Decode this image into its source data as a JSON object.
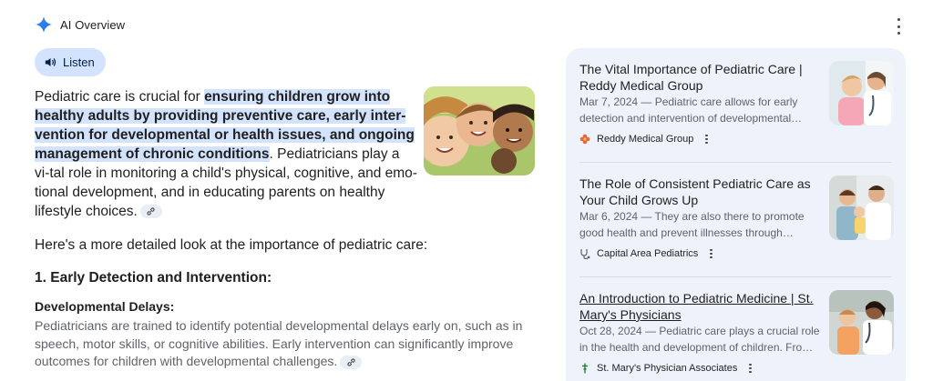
{
  "header": {
    "title": "AI Overview"
  },
  "listen": {
    "label": "Listen"
  },
  "overview": {
    "intro_before": "Pediatric care is crucial for ",
    "intro_highlight": "ensuring children grow into healthy adults by providing preventive care, early inter-vention for developmental or health issues, and ongoing management of chronic conditions",
    "intro_after": ". Pediatricians play a vi-tal role in monitoring a child's physical, cognitive, and emo-tional development, and in educating parents on healthy lifestyle choices.",
    "detail_intro": "Here's a more detailed look at the importance of pediatric care:",
    "section_heading": "1. Early Detection and Intervention:",
    "sub_heading": "Developmental Delays:",
    "sub_text": "Pediatricians are trained to identify potential developmental delays early on, such as in speech, motor skills, or cognitive abilities. Early intervention can significantly improve outcomes for children with developmental challenges."
  },
  "sources": [
    {
      "title": "The Vital Importance of Pediatric Care | Reddy Medical Group",
      "snippet": "Mar 7, 2024 — Pediatric care allows for early detection and intervention of developmental…",
      "site": "Reddy Medical Group",
      "icon": "flower-logo-icon"
    },
    {
      "title": "The Role of Consistent Pediatric Care as Your Child Grows Up",
      "snippet": "Mar 6, 2024 — They are also there to promote good health and prevent illnesses through…",
      "site": "Capital Area Pediatrics",
      "icon": "stethoscope-logo-icon"
    },
    {
      "title": "An Introduction to Pediatric Medicine | St. Mary's Physicians",
      "snippet": "Oct 28, 2024 — Pediatric care plays a crucial role in the health and development of children. Fro…",
      "site": "St. Mary's Physician Associates",
      "icon": "cross-logo-icon"
    }
  ],
  "colors": {
    "accent": "#d3e3fd",
    "panel": "#eef3fb",
    "muted": "#5f6368"
  }
}
